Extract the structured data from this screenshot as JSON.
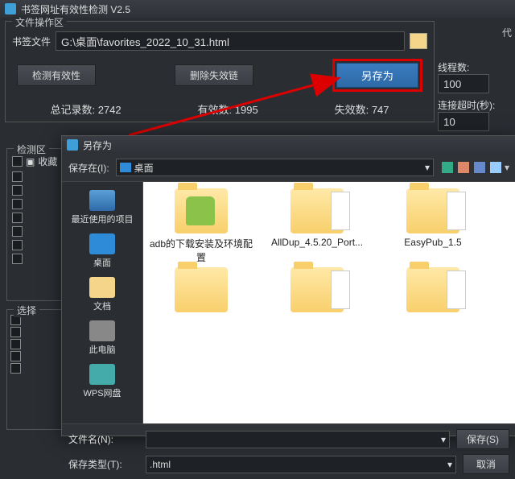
{
  "app": {
    "title": "书签网址有效性检测 V2.5"
  },
  "fileops": {
    "section_label": "文件操作区",
    "bookmark_file_label": "书签文件",
    "bookmark_file_value": "G:\\桌面\\favorites_2022_10_31.html",
    "check_btn": "检测有效性",
    "delete_btn": "删除失效链",
    "saveas_btn": "另存为",
    "total_label": "总记录数:",
    "total_value": "2742",
    "valid_label": "有效数:",
    "valid_value": "1995",
    "invalid_label": "失效数:",
    "invalid_value": "747"
  },
  "right_panel": {
    "proxy_label": "代",
    "threads_label": "线程数:",
    "threads_value": "100",
    "timeout_label": "连接超时(秒):",
    "timeout_value": "10"
  },
  "detect_section": "检测区",
  "tree_root": "收藏",
  "select_label": "选择",
  "dialog": {
    "title": "另存为",
    "savein_label": "保存在(I):",
    "savein_value": "桌面",
    "locations": {
      "recent": "最近使用的项目",
      "desktop": "桌面",
      "docs": "文档",
      "pc": "此电脑",
      "cloud": "WPS网盘"
    },
    "files": {
      "f1": "adb的下载安装及环境配置",
      "f2": "AllDup_4.5.20_Port...",
      "f3": "EasyPub_1.5"
    },
    "filename_label": "文件名(N):",
    "filename_value": "",
    "filetype_label": "保存类型(T):",
    "filetype_value": ".html",
    "save_btn": "保存(S)",
    "cancel_btn": "取消"
  }
}
